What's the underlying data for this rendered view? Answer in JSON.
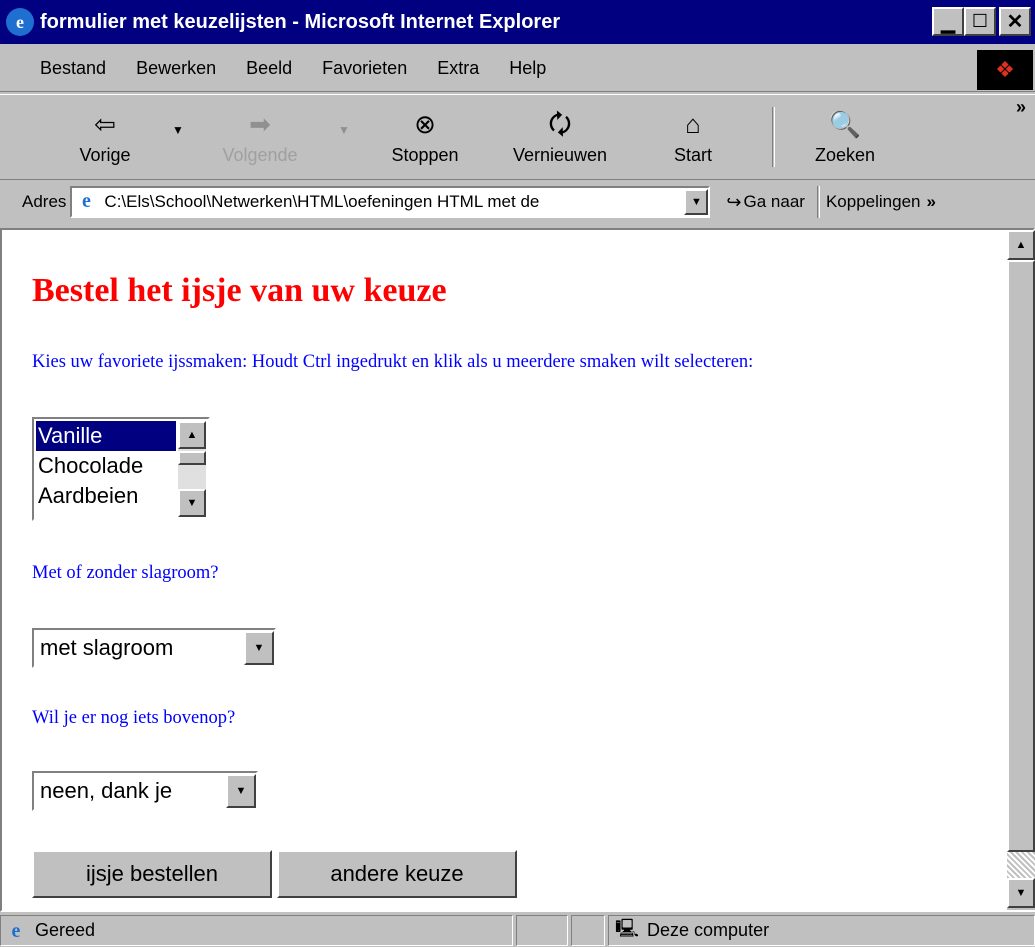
{
  "window": {
    "title": "formulier met keuzelijsten - Microsoft Internet Explorer"
  },
  "menu": [
    "Bestand",
    "Bewerken",
    "Beeld",
    "Favorieten",
    "Extra",
    "Help"
  ],
  "toolbar": {
    "back": "Vorige",
    "forward": "Volgende",
    "stop": "Stoppen",
    "refresh": "Vernieuwen",
    "home": "Start",
    "search": "Zoeken",
    "more": "»"
  },
  "address": {
    "label": "Adres",
    "value": "C:\\Els\\School\\Netwerken\\HTML\\oefeningen HTML met de",
    "go": "Ga naar",
    "links": "Koppelingen"
  },
  "page": {
    "heading": "Bestel het ijsje van uw keuze",
    "intro": "Kies uw favoriete ijssmaken: Houdt Ctrl ingedrukt en klik als u meerdere smaken wilt selecteren:",
    "flavors": [
      "Vanille",
      "Chocolade",
      "Aardbeien"
    ],
    "cream_q": "Met of zonder slagroom?",
    "cream_value": "met slagroom",
    "topping_q": "Wil je er nog iets bovenop?",
    "topping_value": "neen, dank je",
    "order_btn": "ijsje bestellen",
    "reset_btn": "andere keuze"
  },
  "status": {
    "text": "Gereed",
    "zone": "Deze computer"
  },
  "colors": {
    "titlebar": "#000080",
    "heading": "#ff0000",
    "text": "#0000ff",
    "selection": "#000080"
  }
}
